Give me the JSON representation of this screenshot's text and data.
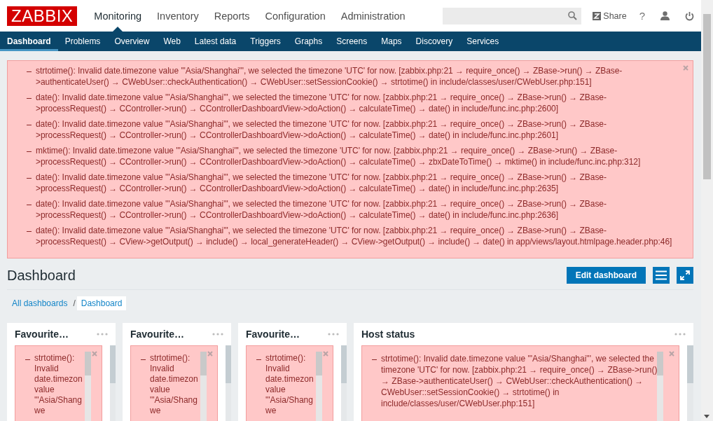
{
  "header": {
    "logo": "ZABBIX",
    "menu": [
      {
        "label": "Monitoring",
        "selected": true
      },
      {
        "label": "Inventory",
        "selected": false
      },
      {
        "label": "Reports",
        "selected": false
      },
      {
        "label": "Configuration",
        "selected": false
      },
      {
        "label": "Administration",
        "selected": false
      }
    ],
    "share": "Share",
    "help": "?"
  },
  "subnav": [
    {
      "label": "Dashboard",
      "selected": true
    },
    {
      "label": "Problems",
      "selected": false
    },
    {
      "label": "Overview",
      "selected": false
    },
    {
      "label": "Web",
      "selected": false
    },
    {
      "label": "Latest data",
      "selected": false
    },
    {
      "label": "Triggers",
      "selected": false
    },
    {
      "label": "Graphs",
      "selected": false
    },
    {
      "label": "Screens",
      "selected": false
    },
    {
      "label": "Maps",
      "selected": false
    },
    {
      "label": "Discovery",
      "selected": false
    },
    {
      "label": "Services",
      "selected": false
    }
  ],
  "messages": [
    "strtotime(): Invalid date.timezone value '\"Asia/Shanghai\"', we selected the timezone 'UTC' for now. [zabbix.php:21 → require_once() → ZBase->run() → ZBase->authenticateUser() → CWebUser::checkAuthentication() → CWebUser::setSessionCookie() → strtotime() in include/classes/user/CWebUser.php:151]",
    "date(): Invalid date.timezone value '\"Asia/Shanghai\"', we selected the timezone 'UTC' for now. [zabbix.php:21 → require_once() → ZBase->run() → ZBase->processRequest() → CController->run() → CControllerDashboardView->doAction() → calculateTime() → date() in include/func.inc.php:2600]",
    "date(): Invalid date.timezone value '\"Asia/Shanghai\"', we selected the timezone 'UTC' for now. [zabbix.php:21 → require_once() → ZBase->run() → ZBase->processRequest() → CController->run() → CControllerDashboardView->doAction() → calculateTime() → date() in include/func.inc.php:2601]",
    "mktime(): Invalid date.timezone value '\"Asia/Shanghai\"', we selected the timezone 'UTC' for now. [zabbix.php:21 → require_once() → ZBase->run() → ZBase->processRequest() → CController->run() → CControllerDashboardView->doAction() → calculateTime() → zbxDateToTime() → mktime() in include/func.inc.php:312]",
    "date(): Invalid date.timezone value '\"Asia/Shanghai\"', we selected the timezone 'UTC' for now. [zabbix.php:21 → require_once() → ZBase->run() → ZBase->processRequest() → CController->run() → CControllerDashboardView->doAction() → calculateTime() → date() in include/func.inc.php:2635]",
    "date(): Invalid date.timezone value '\"Asia/Shanghai\"', we selected the timezone 'UTC' for now. [zabbix.php:21 → require_once() → ZBase->run() → ZBase->processRequest() → CController->run() → CControllerDashboardView->doAction() → calculateTime() → date() in include/func.inc.php:2636]",
    "date(): Invalid date.timezone value '\"Asia/Shanghai\"', we selected the timezone 'UTC' for now. [zabbix.php:21 → require_once() → ZBase->run() → ZBase->processRequest() → CView->getOutput() → include() → local_generateHeader() → CView->getOutput() → include() → date() in app/views/layout.htmlpage.header.php:46]"
  ],
  "page_title": "Dashboard",
  "edit_button": "Edit dashboard",
  "breadcrumb_separator": "/",
  "breadcrumbs": [
    {
      "label": "All dashboards",
      "selected": false
    },
    {
      "label": "Dashboard",
      "selected": true
    }
  ],
  "widgets": [
    {
      "kind": "narrow",
      "title": "Favourite…",
      "message": "strtotime(): Invalid date.timezon value '\"Asia/Shang we"
    },
    {
      "kind": "narrow",
      "title": "Favourite…",
      "message": "strtotime(): Invalid date.timezon value '\"Asia/Shang we"
    },
    {
      "kind": "narrow",
      "title": "Favourite…",
      "message": "strtotime(): Invalid date.timezon value '\"Asia/Shang we"
    },
    {
      "kind": "wide",
      "title": "Host status",
      "message": "strtotime(): Invalid date.timezone value '\"Asia/Shanghai\"', we selected the timezone 'UTC' for now. [zabbix.php:21 → require_once() → ZBase->run() → ZBase->authenticateUser() → CWebUser::checkAuthentication() → CWebUser::setSessionCookie() → strtotime() in include/classes/user/CWebUser.php:151]"
    }
  ]
}
